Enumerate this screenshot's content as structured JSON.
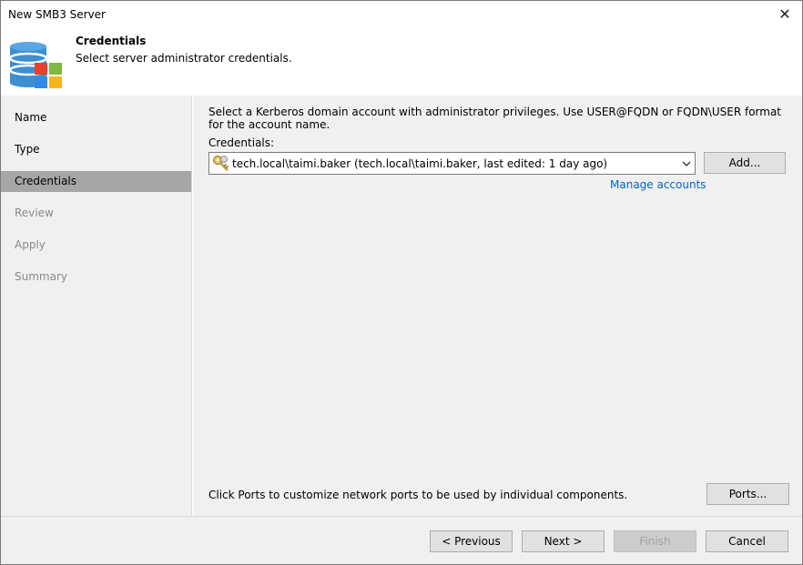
{
  "window": {
    "title": "New SMB3 Server",
    "close_label": "✕"
  },
  "header": {
    "title": "Credentials",
    "subtitle": "Select server administrator credentials."
  },
  "steps": [
    {
      "label": "Name",
      "state": "done"
    },
    {
      "label": "Type",
      "state": "done"
    },
    {
      "label": "Credentials",
      "state": "active"
    },
    {
      "label": "Review",
      "state": "disabled"
    },
    {
      "label": "Apply",
      "state": "disabled"
    },
    {
      "label": "Summary",
      "state": "disabled"
    }
  ],
  "main": {
    "description": "Select a Kerberos domain account with administrator privileges. Use USER@FQDN or FQDN\\USER format for the account name.",
    "credentials_label": "Credentials:",
    "credentials_value": "tech.local\\taimi.baker (tech.local\\taimi.baker, last edited: 1 day ago)",
    "add_button": "Add...",
    "manage_link": "Manage accounts",
    "ports_text": "Click Ports to customize network ports to be used by individual components.",
    "ports_button": "Ports..."
  },
  "footer": {
    "previous": "< Previous",
    "next": "Next >",
    "finish": "Finish",
    "cancel": "Cancel"
  },
  "icons": {
    "header": "database-windows-icon",
    "credentials": "key-icon",
    "dropdown": "chevron-down-icon",
    "close": "close-icon"
  },
  "colors": {
    "active_step_bg": "#a6a6a6",
    "panel_bg": "#f0f0f0",
    "link": "#0066cc"
  }
}
